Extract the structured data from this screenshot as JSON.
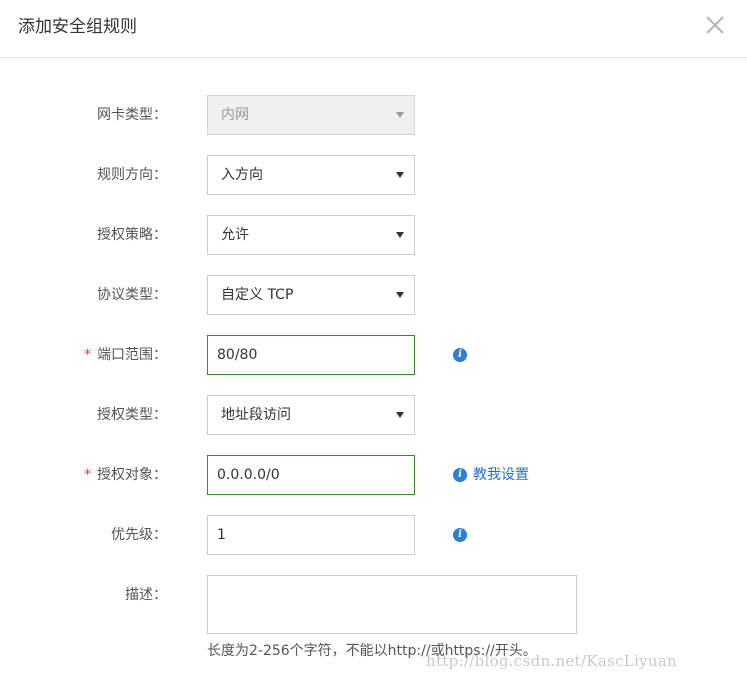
{
  "dialog": {
    "title": "添加安全组规则",
    "close_icon": "close-icon"
  },
  "fields": {
    "nic_type": {
      "label": "网卡类型：",
      "value": "内网",
      "disabled": true
    },
    "direction": {
      "label": "规则方向：",
      "value": "入方向"
    },
    "policy": {
      "label": "授权策略：",
      "value": "允许"
    },
    "protocol": {
      "label": "协议类型：",
      "value": "自定义 TCP"
    },
    "port_range": {
      "required_mark": "*",
      "label": "端口范围：",
      "value": "80/80"
    },
    "auth_type": {
      "label": "授权类型：",
      "value": "地址段访问"
    },
    "auth_object": {
      "required_mark": "*",
      "label": "授权对象：",
      "value": "0.0.0.0/0",
      "help_link": "教我设置"
    },
    "priority": {
      "label": "优先级：",
      "value": "1"
    },
    "description": {
      "label": "描述：",
      "value": "",
      "hint": "长度为2-256个字符，不能以http://或https://开头。"
    }
  },
  "info_icon_glyph": "i",
  "watermark": "http://blog.csdn.net/KascLiyuan",
  "colors": {
    "valid_border": "#3c8a2e",
    "required": "#e4393c",
    "info": "#2d7ddb",
    "link": "#1f6fd0"
  }
}
